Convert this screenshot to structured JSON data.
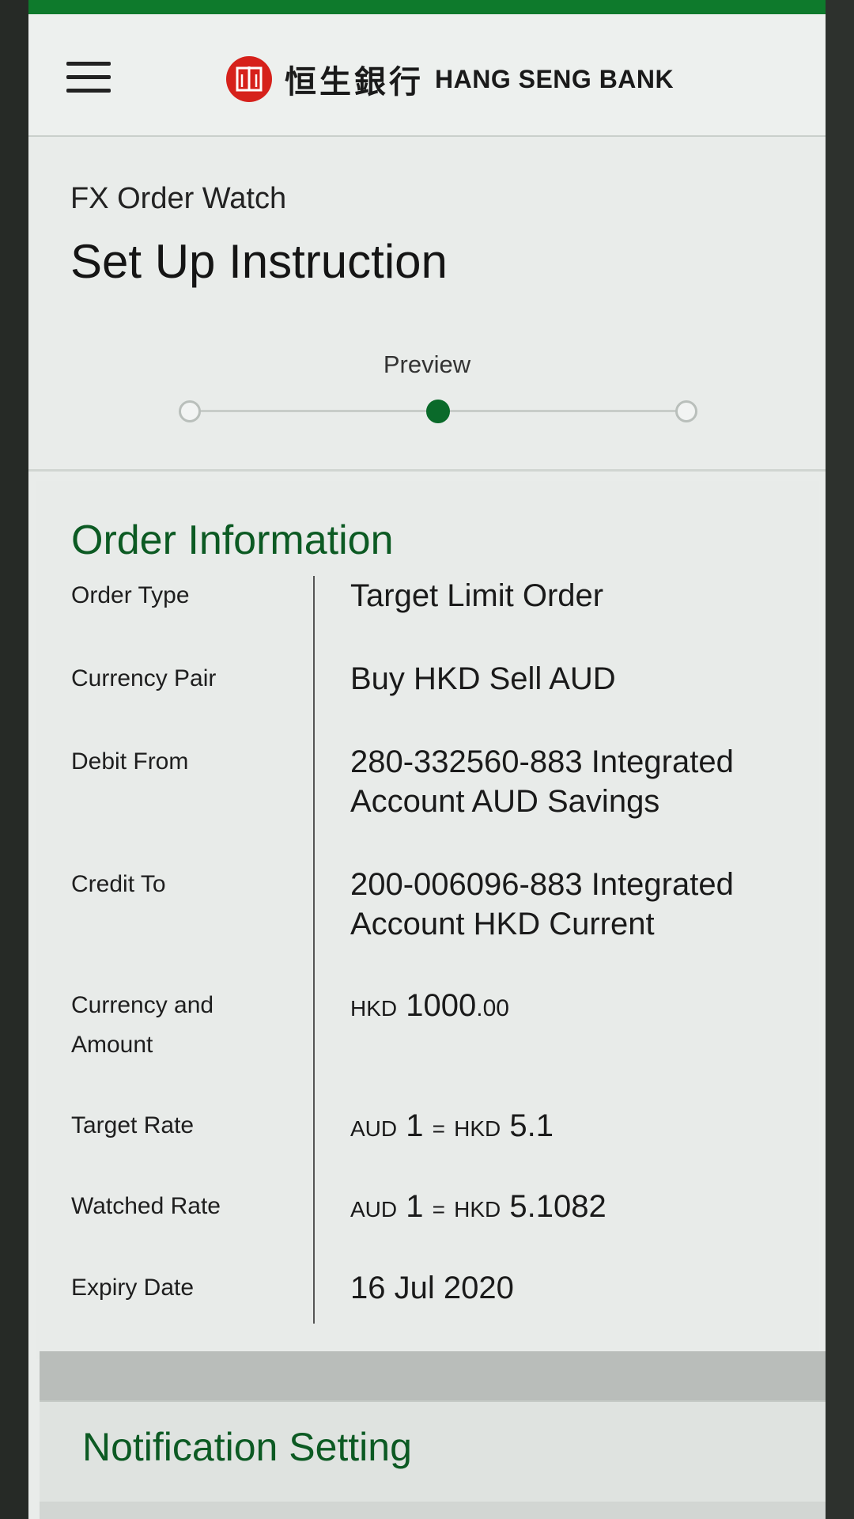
{
  "header": {
    "bank_name_cn": "恒生銀行",
    "bank_name_en": "HANG SENG BANK",
    "menu_icon": "hamburger-menu-icon",
    "logo_icon": "hang-seng-logo",
    "brand_red": "#d6211b"
  },
  "page": {
    "breadcrumb": "FX Order Watch",
    "title": "Set Up Instruction"
  },
  "stepper": {
    "current_label": "Preview",
    "current_step": 2,
    "total_steps": 3,
    "active_color": "#0a6a2a"
  },
  "order_info": {
    "title": "Order Information",
    "rows": {
      "order_type": {
        "label": "Order Type",
        "value": "Target Limit Order"
      },
      "currency_pair": {
        "label": "Currency Pair",
        "value": "Buy HKD Sell AUD"
      },
      "debit_from": {
        "label": "Debit From",
        "line1": "280-332560-883 Integrated",
        "line2": "Account AUD Savings"
      },
      "credit_to": {
        "label": "Credit To",
        "line1": "200-006096-883 Integrated",
        "line2": "Account HKD Current"
      },
      "currency_amount": {
        "label_line1": "Currency and",
        "label_line2": "Amount",
        "currency": "HKD",
        "amount_int": "1000",
        "amount_dec": ".00"
      },
      "target_rate": {
        "label": "Target Rate",
        "from_ccy": "AUD",
        "from_amt": "1",
        "eq": "=",
        "to_ccy": "HKD",
        "to_amt": "5.1"
      },
      "watched_rate": {
        "label": "Watched Rate",
        "from_ccy": "AUD",
        "from_amt": "1",
        "eq": "=",
        "to_ccy": "HKD",
        "to_amt": "5.1082"
      },
      "expiry_date": {
        "label": "Expiry Date",
        "value": "16 Jul 2020"
      }
    }
  },
  "notification": {
    "title": "Notification Setting"
  },
  "theme": {
    "section_green": "#0c5a23",
    "status_bar_green": "#0e7a2c"
  }
}
